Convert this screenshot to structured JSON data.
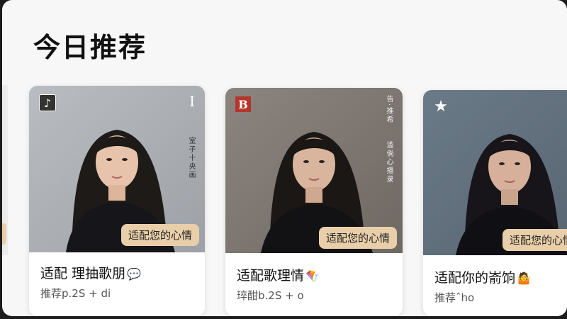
{
  "header": {
    "title": "今日推荐"
  },
  "cards": [
    {
      "badge": "适配您的心情",
      "title": "适配 理抽歌朋",
      "title_emoji": "💬",
      "subtitle": "推荐p.2S + di",
      "corner_icon": "music-note-icon",
      "corner_letter": "I",
      "side_text": "室子十央画"
    },
    {
      "badge": "适配您的心情",
      "title": "适配歌理情",
      "title_emoji": "🪁",
      "subtitle": "琗酣b.2S + o",
      "corner_icon_text": "B",
      "corner_icon": "bookmark-b-icon",
      "side_text_top": "告·推希",
      "side_text": "滥倘心播录"
    },
    {
      "badge": "适配您的心情",
      "title": "适配你的嵛饷",
      "title_emoji": "🤷",
      "subtitle": "推荐ˆho",
      "corner_icon": "star-icon"
    }
  ],
  "colors": {
    "badge_bg": "#e9cfa9",
    "card_bg": "#ffffff",
    "page_bg": "#f7f7f7"
  }
}
